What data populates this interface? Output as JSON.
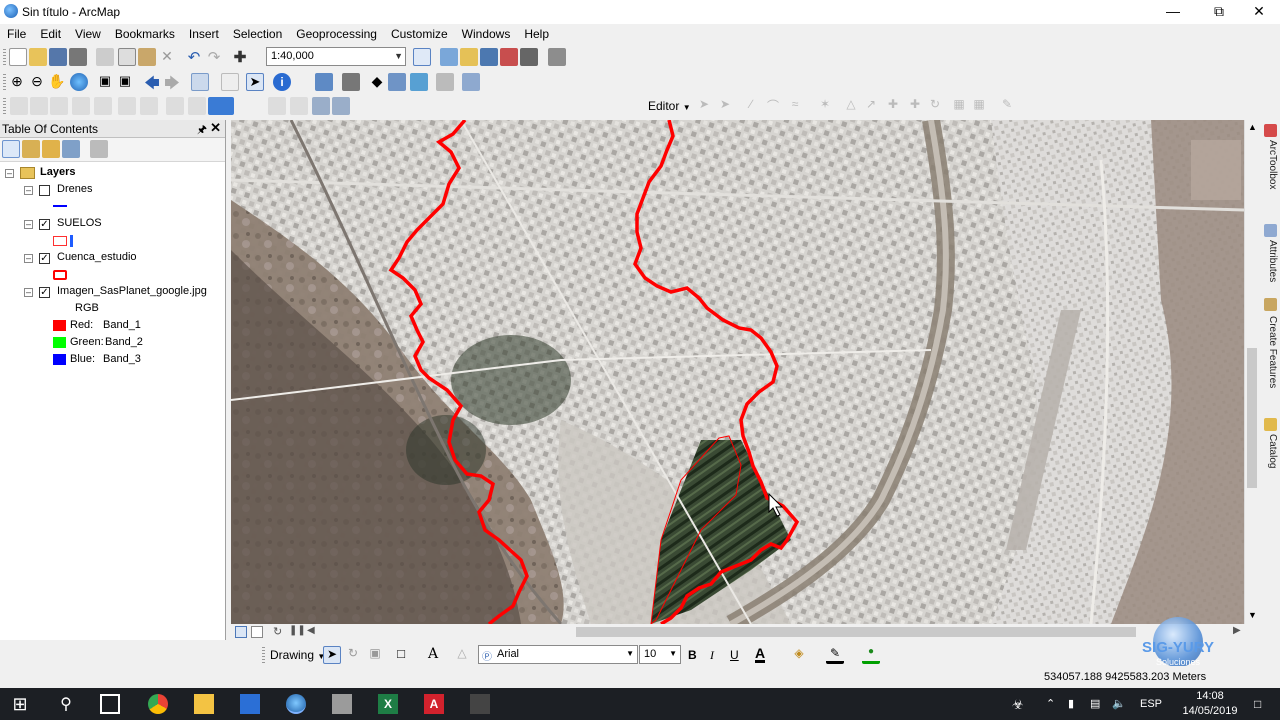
{
  "window": {
    "title": "Sin título - ArcMap"
  },
  "menu": [
    "File",
    "Edit",
    "View",
    "Bookmarks",
    "Insert",
    "Selection",
    "Geoprocessing",
    "Customize",
    "Windows",
    "Help"
  ],
  "standard_toolbar": {
    "scale": "1:40,000"
  },
  "editor_toolbar": {
    "label": "Editor"
  },
  "toc": {
    "title": "Table Of Contents",
    "root": "Layers",
    "layers": [
      {
        "name": "Drenes",
        "checked": false
      },
      {
        "name": "SUELOS",
        "checked": true
      },
      {
        "name": "Cuenca_estudio",
        "checked": true
      },
      {
        "name": "Imagen_SasPlanet_google.jpg",
        "checked": true
      }
    ],
    "rgb_label": "RGB",
    "bands": [
      {
        "channel": "Red:",
        "band": "Band_1",
        "color": "#ff0000"
      },
      {
        "channel": "Green:",
        "band": "Band_2",
        "color": "#00ff00"
      },
      {
        "channel": "Blue:",
        "band": "Band_3",
        "color": "#0000ff"
      }
    ]
  },
  "right_dock": [
    "ArcToolbox",
    "Attributes",
    "Create Features",
    "Catalog"
  ],
  "drawing_toolbar": {
    "label": "Drawing",
    "font": "Arial",
    "size": "10",
    "bold": "B",
    "italic": "I",
    "underline": "U",
    "text_tool": "A",
    "font_color": "A"
  },
  "status": {
    "coordinates": "534057.188  9425583.203 Meters"
  },
  "watermark": {
    "brand": "SIG-YURY",
    "sub": "Soluciones"
  },
  "taskbar": {
    "language": "ESP",
    "time": "14:08",
    "date": "14/05/2019"
  },
  "colors": {
    "boundary": "#ff0000",
    "drain_line": "#0000ff"
  }
}
